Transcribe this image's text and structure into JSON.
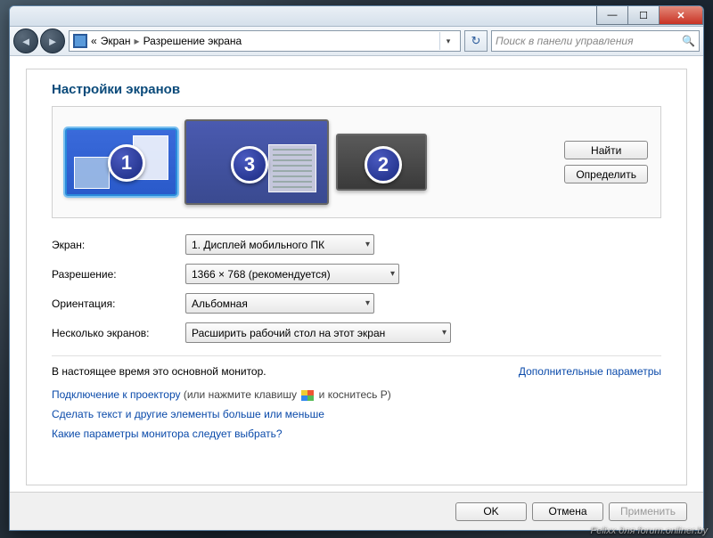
{
  "breadcrumb": {
    "root_prefix": "«",
    "root": "Экран",
    "current": "Разрешение экрана"
  },
  "search": {
    "placeholder": "Поиск в панели управления"
  },
  "heading": "Настройки экранов",
  "monitors": {
    "m1": "1",
    "m2": "2",
    "m3": "3"
  },
  "sidebuttons": {
    "detect": "Найти",
    "identify": "Определить"
  },
  "form": {
    "display_label": "Экран:",
    "display_value": "1. Дисплей мобильного ПК",
    "resolution_label": "Разрешение:",
    "resolution_value": "1366 × 768 (рекомендуется)",
    "orientation_label": "Ориентация:",
    "orientation_value": "Альбомная",
    "multi_label": "Несколько экранов:",
    "multi_value": "Расширить рабочий стол на этот экран"
  },
  "status": "В настоящее время это основной монитор.",
  "adv_link": "Дополнительные параметры",
  "proj": {
    "link": "Подключение к проектору",
    "before": " (или нажмите клавишу ",
    "after": " и коснитесь P)"
  },
  "textsize_link": "Сделать текст и другие элементы больше или меньше",
  "which_link": "Какие параметры монитора следует выбрать?",
  "footer": {
    "ok": "OK",
    "cancel": "Отмена",
    "apply": "Применить"
  },
  "watermark": "Felixx для forum.onliner.by"
}
